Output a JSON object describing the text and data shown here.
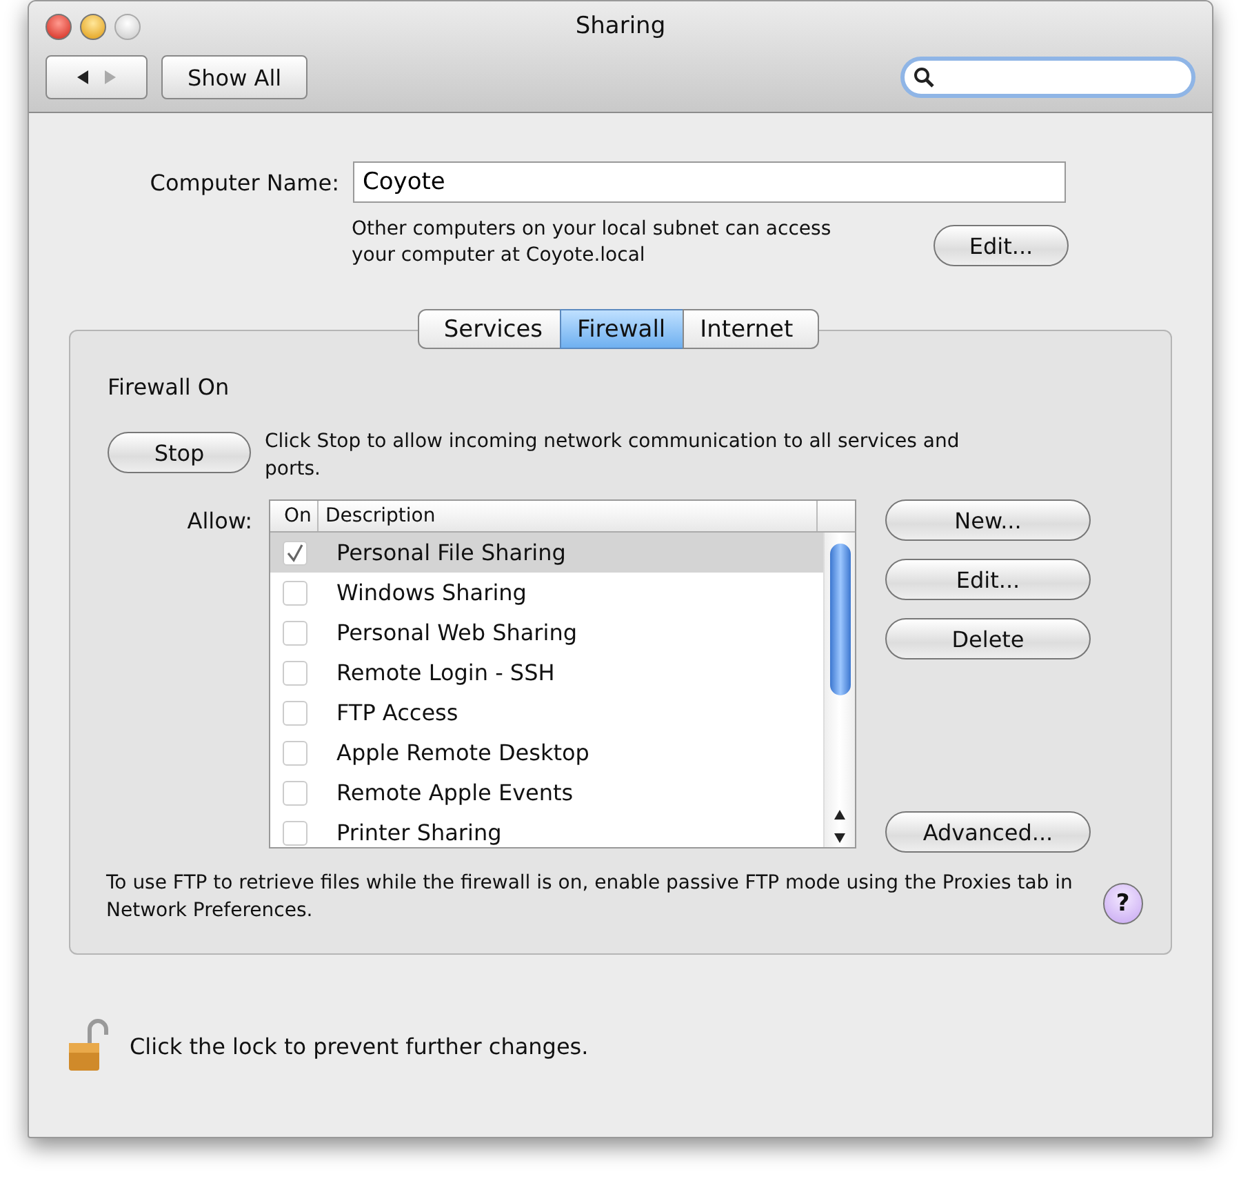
{
  "window": {
    "title": "Sharing"
  },
  "toolbar": {
    "show_all": "Show All"
  },
  "computer_name": {
    "label": "Computer Name:",
    "value": "Coyote",
    "info": "Other computers on your local subnet can access your computer at Coyote.local",
    "edit_button": "Edit..."
  },
  "tabs": [
    {
      "label": "Services",
      "selected": false
    },
    {
      "label": "Firewall",
      "selected": true
    },
    {
      "label": "Internet",
      "selected": false
    }
  ],
  "firewall": {
    "status": "Firewall On",
    "stop_button": "Stop",
    "stop_info": "Click Stop to allow incoming network communication to all services and ports.",
    "allow_label": "Allow:"
  },
  "table": {
    "columns": [
      "On",
      "Description"
    ],
    "rows": [
      {
        "description": "Personal File Sharing",
        "checked": true,
        "selected": true
      },
      {
        "description": "Windows Sharing",
        "checked": false,
        "selected": false
      },
      {
        "description": "Personal Web Sharing",
        "checked": false,
        "selected": false
      },
      {
        "description": "Remote Login - SSH",
        "checked": false,
        "selected": false
      },
      {
        "description": "FTP Access",
        "checked": false,
        "selected": false
      },
      {
        "description": "Apple Remote Desktop",
        "checked": false,
        "selected": false
      },
      {
        "description": "Remote Apple Events",
        "checked": false,
        "selected": false
      },
      {
        "description": "Printer Sharing",
        "checked": false,
        "selected": false
      }
    ]
  },
  "side_buttons": [
    "New...",
    "Edit...",
    "Delete",
    "Advanced..."
  ],
  "note": "To use FTP to retrieve files while the firewall is on, enable passive FTP mode using the Proxies tab in Network Preferences.",
  "help_button": "?",
  "lock_text": "Click the lock to prevent further changes."
}
